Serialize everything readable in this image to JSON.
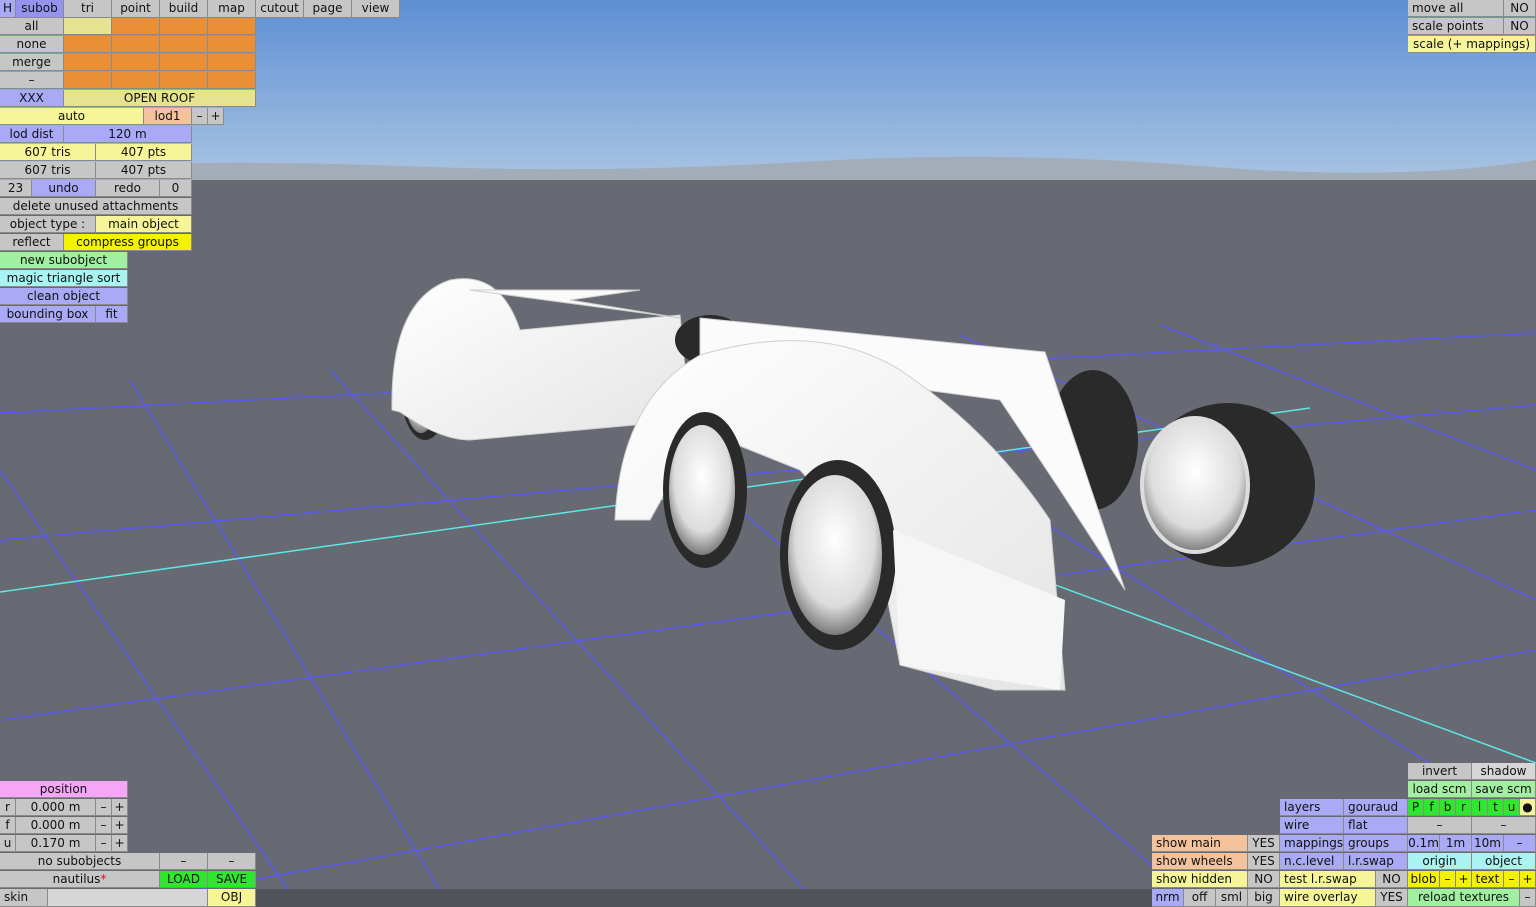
{
  "top_menu": {
    "h": "H",
    "subob": "subob",
    "tri": "tri",
    "point": "point",
    "build": "build",
    "map": "map",
    "cutout": "cutout",
    "page": "page",
    "view": "view"
  },
  "select": {
    "all": "all",
    "none": "none",
    "merge": "merge",
    "minus": "–"
  },
  "group": {
    "xxx": "XXX",
    "name": "OPEN ROOF"
  },
  "lod": {
    "auto": "auto",
    "lod1": "lod1",
    "minus": "–",
    "plus": "+",
    "lod_dist_label": "lod dist",
    "lod_dist_value": "120 m"
  },
  "stats": {
    "tris1": "607 tris",
    "pts1": "407 pts",
    "tris2": "607 tris",
    "pts2": "407 pts"
  },
  "history": {
    "undo_count": "23",
    "undo": "undo",
    "redo": "redo",
    "redo_count": "0"
  },
  "actions": {
    "delete_unused": "delete unused attachments",
    "object_type_label": "object type :",
    "object_type_value": "main object",
    "reflect": "reflect",
    "compress_groups": "compress groups",
    "new_subobject": "new subobject",
    "magic_sort": "magic triangle sort",
    "clean_object": "clean object",
    "bounding_box": "bounding box",
    "fit": "fit"
  },
  "top_right": {
    "move_all": "move all",
    "move_all_val": "NO",
    "scale_points": "scale points",
    "scale_points_val": "NO",
    "scale_mappings": "scale (+ mappings)"
  },
  "position": {
    "title": "position",
    "r_label": "r",
    "r_value": "0.000 m",
    "f_label": "f",
    "f_value": "0.000 m",
    "u_label": "u",
    "u_value": "0.170 m",
    "minus": "–",
    "plus": "+"
  },
  "file": {
    "no_subobjects": "no subobjects",
    "minus": "–",
    "name": "nautilus",
    "modified": "*",
    "load": "LOAD",
    "save": "SAVE",
    "skin": "skin",
    "obj": "OBJ"
  },
  "bottom_right": {
    "invert": "invert",
    "shadow": "shadow",
    "load_scm": "load scm",
    "save_scm": "save scm",
    "layers": "layers",
    "gouraud": "gouraud",
    "wire": "wire",
    "flat": "flat",
    "flags": [
      "P",
      "f",
      "b",
      "r",
      "l",
      "t",
      "u",
      "●"
    ],
    "minus": "–",
    "show_main": "show main",
    "show_main_val": "YES",
    "mappings": "mappings",
    "groups": "groups",
    "step_01": "0.1m",
    "step_1": "1m",
    "step_10": "10m",
    "show_wheels": "show wheels",
    "show_wheels_val": "YES",
    "nc_level": "n.c.level",
    "lr_swap": "l.r.swap",
    "origin": "origin",
    "object": "object",
    "show_hidden": "show hidden",
    "show_hidden_val": "NO",
    "test_lr_swap": "test l.r.swap",
    "test_lr_swap_val": "NO",
    "blob": "blob",
    "text": "text",
    "plus": "+",
    "nrm": "nrm",
    "off": "off",
    "sml": "sml",
    "big": "big",
    "wire_overlay": "wire overlay",
    "wire_overlay_val": "YES",
    "reload_textures": "reload textures"
  }
}
